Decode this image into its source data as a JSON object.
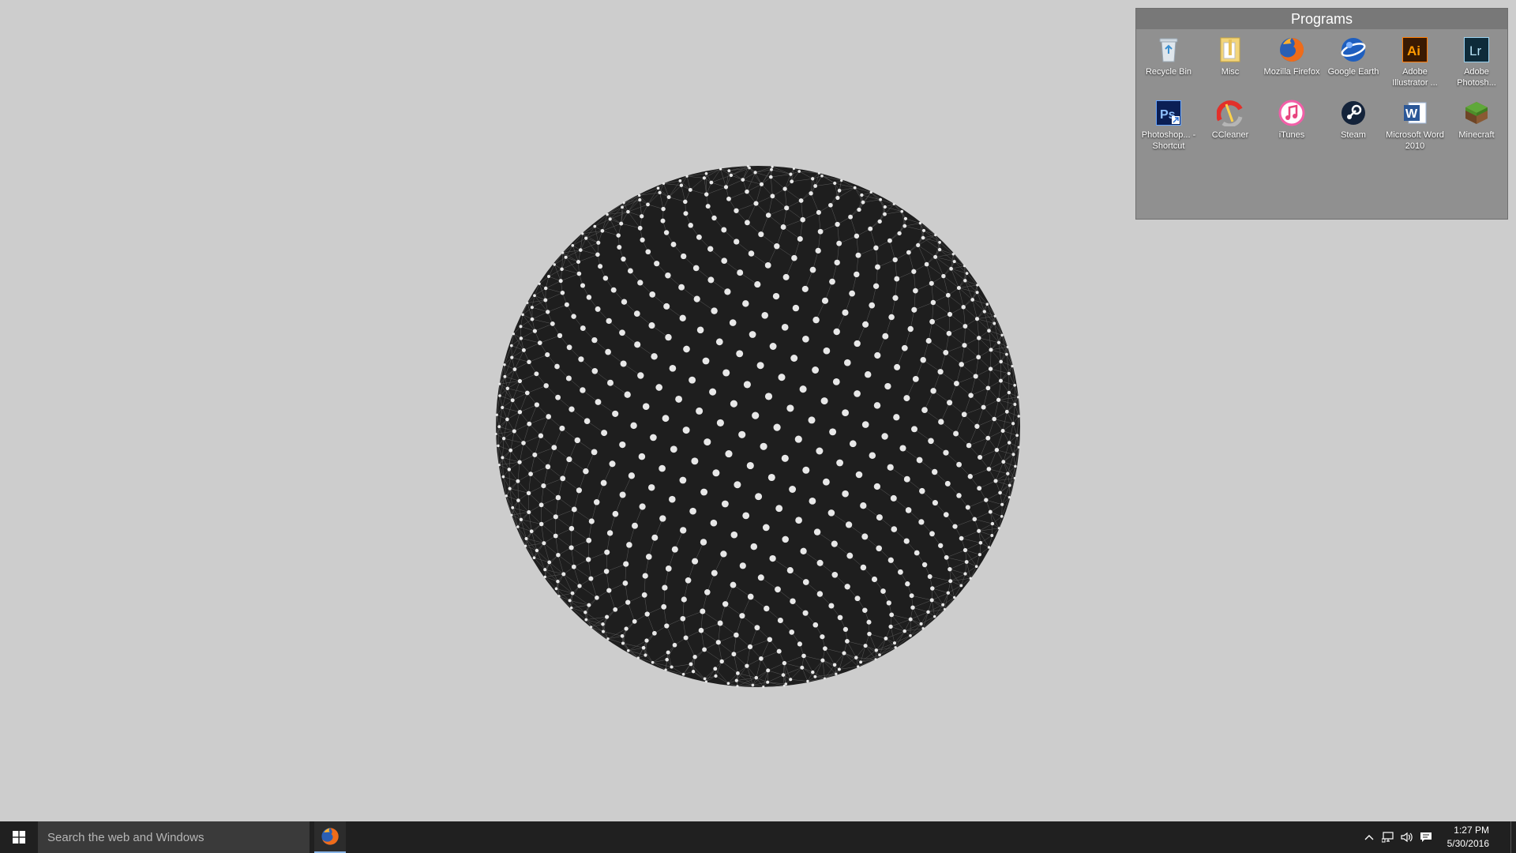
{
  "fence": {
    "title": "Programs",
    "items": [
      {
        "label": "Recycle Bin",
        "icon": "recycle-bin-icon"
      },
      {
        "label": "Misc",
        "icon": "folder-icon"
      },
      {
        "label": "Mozilla Firefox",
        "icon": "firefox-icon"
      },
      {
        "label": "Google Earth",
        "icon": "google-earth-icon"
      },
      {
        "label": "Adobe Illustrator ...",
        "icon": "illustrator-icon"
      },
      {
        "label": "Adobe Photosh...",
        "icon": "lightroom-icon"
      },
      {
        "label": "Photoshop... - Shortcut",
        "icon": "photoshop-icon"
      },
      {
        "label": "CCleaner",
        "icon": "ccleaner-icon"
      },
      {
        "label": "iTunes",
        "icon": "itunes-icon"
      },
      {
        "label": "Steam",
        "icon": "steam-icon"
      },
      {
        "label": "Microsoft Word 2010",
        "icon": "word-icon"
      },
      {
        "label": "Minecraft",
        "icon": "minecraft-icon"
      }
    ]
  },
  "taskbar": {
    "search_placeholder": "Search the web and Windows",
    "pinned": [
      {
        "name": "Mozilla Firefox",
        "icon": "firefox-icon"
      }
    ],
    "tray_icons": [
      "chevron-up-icon",
      "network-icon",
      "volume-icon",
      "action-center-icon"
    ],
    "time": "1:27 PM",
    "date": "5/30/2016"
  },
  "colors": {
    "desktop": "#cdcdcd",
    "taskbar": "#202020",
    "sphere": "#1e1e1e",
    "dots": "#e8e8e8"
  }
}
